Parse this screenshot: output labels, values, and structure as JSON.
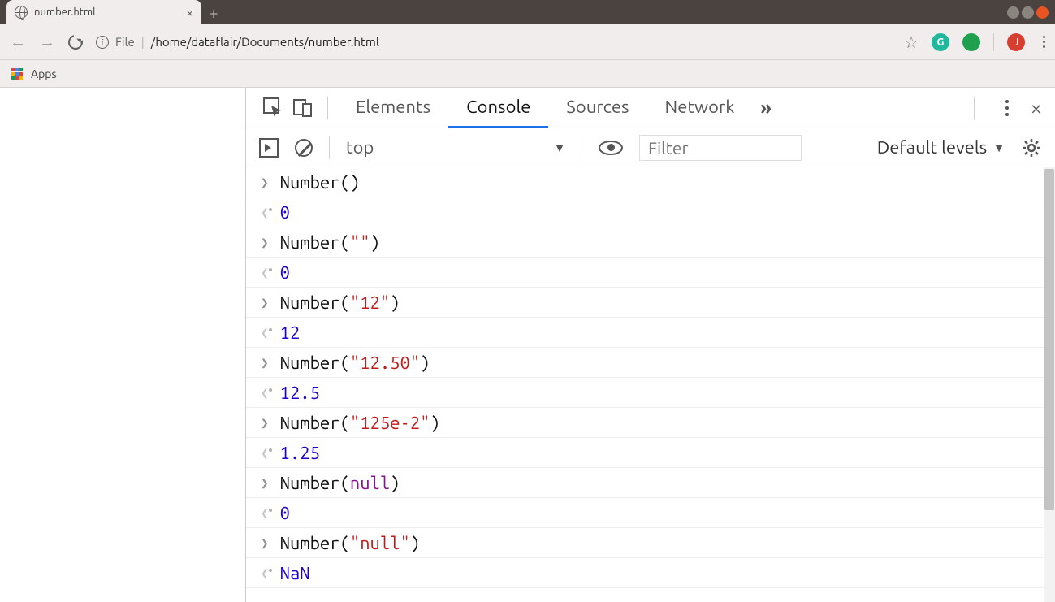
{
  "browser": {
    "tab_title": "number.html",
    "url_scheme": "File",
    "url_path": "/home/dataflair/Documents/number.html",
    "apps_label": "Apps",
    "profile_letter": "J",
    "grammarly_letter": "G"
  },
  "devtools": {
    "tabs": {
      "elements": "Elements",
      "console": "Console",
      "sources": "Sources",
      "network": "Network"
    },
    "context": "top",
    "filter_placeholder": "Filter",
    "levels_label": "Default levels"
  },
  "console": {
    "rows": [
      {
        "type": "in",
        "parts": [
          {
            "t": "fn",
            "v": "Number()"
          }
        ]
      },
      {
        "type": "out",
        "parts": [
          {
            "t": "num",
            "v": "0"
          }
        ]
      },
      {
        "type": "in",
        "parts": [
          {
            "t": "fn",
            "v": "Number("
          },
          {
            "t": "str",
            "v": "\"\""
          },
          {
            "t": "fn",
            "v": ")"
          }
        ]
      },
      {
        "type": "out",
        "parts": [
          {
            "t": "num",
            "v": "0"
          }
        ]
      },
      {
        "type": "in",
        "parts": [
          {
            "t": "fn",
            "v": "Number("
          },
          {
            "t": "str",
            "v": "\"12\""
          },
          {
            "t": "fn",
            "v": ")"
          }
        ]
      },
      {
        "type": "out",
        "parts": [
          {
            "t": "num",
            "v": "12"
          }
        ]
      },
      {
        "type": "in",
        "parts": [
          {
            "t": "fn",
            "v": "Number("
          },
          {
            "t": "str",
            "v": "\"12.50\""
          },
          {
            "t": "fn",
            "v": ")"
          }
        ]
      },
      {
        "type": "out",
        "parts": [
          {
            "t": "num",
            "v": "12.5"
          }
        ]
      },
      {
        "type": "in",
        "parts": [
          {
            "t": "fn",
            "v": "Number("
          },
          {
            "t": "str",
            "v": "\"125e-2\""
          },
          {
            "t": "fn",
            "v": ")"
          }
        ]
      },
      {
        "type": "out",
        "parts": [
          {
            "t": "num",
            "v": "1.25"
          }
        ]
      },
      {
        "type": "in",
        "parts": [
          {
            "t": "fn",
            "v": "Number("
          },
          {
            "t": "kw",
            "v": "null"
          },
          {
            "t": "fn",
            "v": ")"
          }
        ]
      },
      {
        "type": "out",
        "parts": [
          {
            "t": "num",
            "v": "0"
          }
        ]
      },
      {
        "type": "in",
        "parts": [
          {
            "t": "fn",
            "v": "Number("
          },
          {
            "t": "str",
            "v": "\"null\""
          },
          {
            "t": "fn",
            "v": ")"
          }
        ]
      },
      {
        "type": "out",
        "parts": [
          {
            "t": "num",
            "v": "NaN"
          }
        ]
      }
    ]
  }
}
